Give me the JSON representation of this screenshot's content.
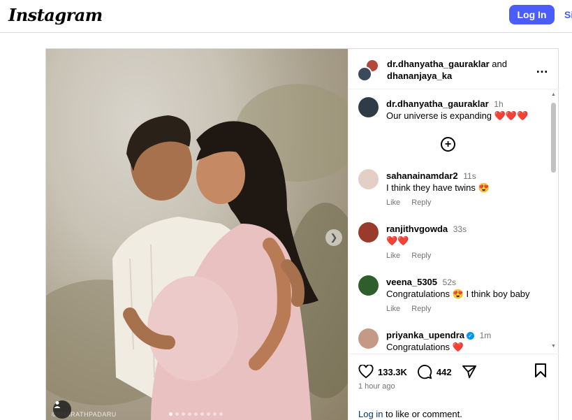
{
  "header": {
    "logo": "Instagram",
    "login_label": "Log In",
    "signup_label": "Si"
  },
  "post": {
    "authors": {
      "primary": "dr.dhanyatha_gauraklar",
      "joiner": "and",
      "secondary": "dhananjaya_ka"
    },
    "watermark": "©SHARATHPADARU",
    "carousel": {
      "slides": 9,
      "active": 1
    },
    "caption": {
      "user": "dr.dhanyatha_gauraklar",
      "time": "1h",
      "text": "Our universe is expanding ❤️❤️❤️"
    },
    "comments": [
      {
        "user": "sahanainamdar2",
        "time": "11s",
        "text": "I think they have twins 😍",
        "like": "Like",
        "reply": "Reply",
        "verified": false
      },
      {
        "user": "ranjithvgowda",
        "time": "33s",
        "text": "❤️❤️",
        "like": "Like",
        "reply": "Reply",
        "verified": false
      },
      {
        "user": "veena_5305",
        "time": "52s",
        "text": "Congratulations 😍 I think boy baby",
        "like": "Like",
        "reply": "Reply",
        "verified": false
      },
      {
        "user": "priyanka_upendra",
        "time": "1m",
        "text": "Congratulations ❤️",
        "verified": true
      }
    ],
    "likes": "133.3K",
    "comment_count": "442",
    "time_ago": "1 hour ago",
    "login_prompt": {
      "link": "Log in",
      "rest": " to like or comment."
    }
  },
  "icons": {
    "heart": "heart-icon",
    "comment": "comment-icon",
    "share": "share-icon",
    "bookmark": "bookmark-icon",
    "more": "more-options-icon"
  },
  "colors": {
    "accent": "#4a5df9",
    "link": "#00376b",
    "verified": "#0095f6",
    "muted": "#737373"
  }
}
